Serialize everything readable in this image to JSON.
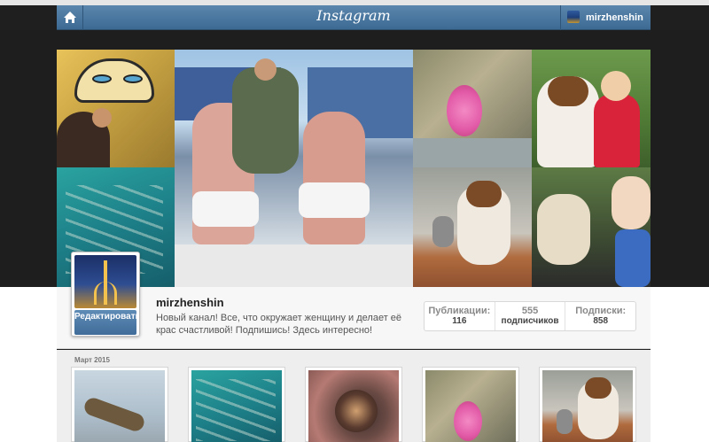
{
  "app": {
    "logo": "Instagram"
  },
  "header": {
    "username": "mirzhenshin"
  },
  "profile": {
    "username": "mirzhenshin",
    "bio": "Новый канал! Все, что окружает женщину и делает её крас счастливой! Подпишись! Здесь интересно!",
    "edit_button": "Редактировать профиль"
  },
  "stats": [
    {
      "label": "Публикации:",
      "value": "116"
    },
    {
      "label": "555",
      "value": "подписчиков"
    },
    {
      "label": "Подписки:",
      "value": "858"
    }
  ],
  "feed": {
    "month_label": "Март 2015"
  },
  "icons": {
    "home": "home-icon"
  },
  "colors": {
    "header": "#4a78a3",
    "band": "#1e1e1e",
    "panel": "#f7f7f7"
  }
}
